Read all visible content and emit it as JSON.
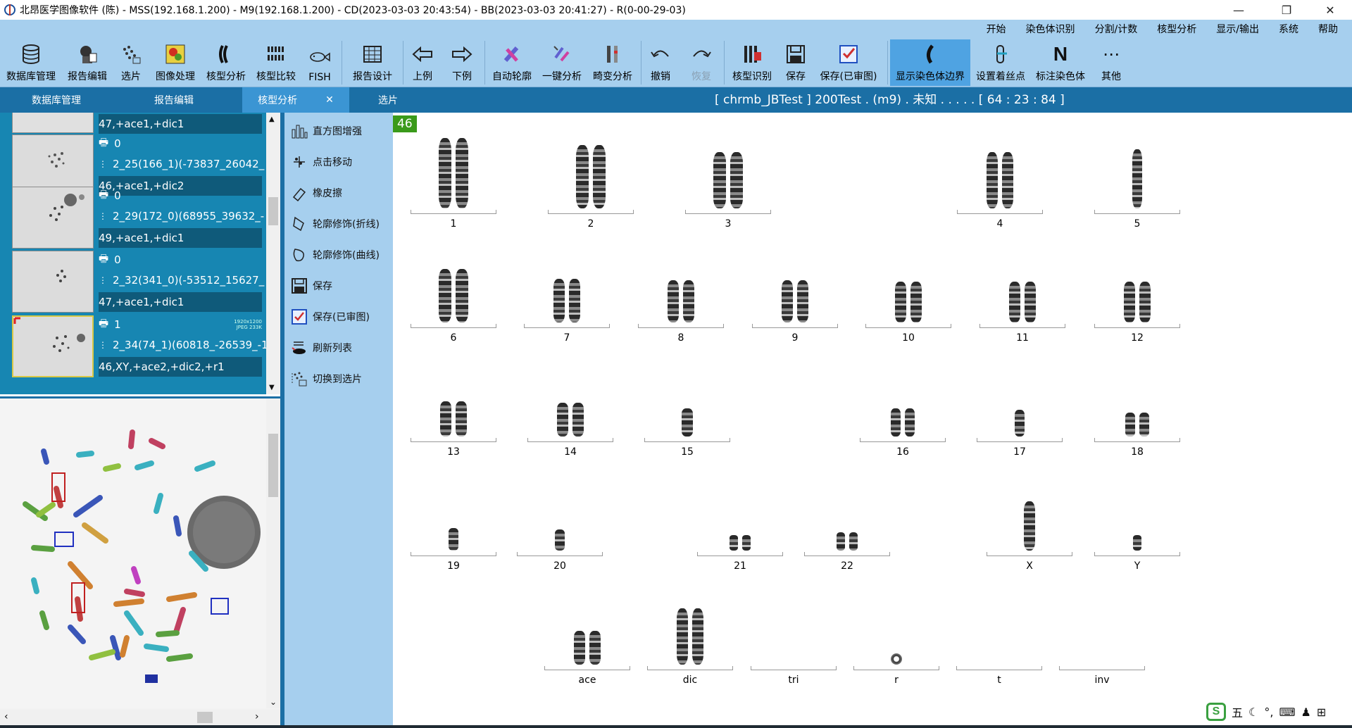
{
  "window": {
    "title": "北昂医学图像软件 (陈) - MSS(192.168.1.200) - M9(192.168.1.200) - CD(2023-03-03 20:43:54) - BB(2023-03-03 20:41:27) - R(0-00-29-03)"
  },
  "menu": [
    "开始",
    "染色体识别",
    "分割/计数",
    "核型分析",
    "显示/输出",
    "系统",
    "帮助"
  ],
  "toolbar": [
    {
      "label": "数据库管理",
      "icon": "database-icon"
    },
    {
      "label": "报告编辑",
      "icon": "report-edit-icon"
    },
    {
      "label": "选片",
      "icon": "select-slide-icon"
    },
    {
      "label": "图像处理",
      "icon": "image-process-icon"
    },
    {
      "label": "核型分析",
      "icon": "karyotype-icon"
    },
    {
      "label": "核型比较",
      "icon": "karyo-compare-icon"
    },
    {
      "label": "FISH",
      "icon": "fish-icon"
    },
    {
      "label": "报告设计",
      "icon": "report-design-icon"
    },
    {
      "label": "上例",
      "icon": "prev-case-icon"
    },
    {
      "label": "下例",
      "icon": "next-case-icon"
    },
    {
      "label": "自动轮廓",
      "icon": "auto-contour-icon"
    },
    {
      "label": "一键分析",
      "icon": "one-click-icon"
    },
    {
      "label": "畸变分析",
      "icon": "aberration-icon"
    },
    {
      "label": "撤销",
      "icon": "undo-icon"
    },
    {
      "label": "恢复",
      "icon": "redo-icon"
    },
    {
      "label": "核型识别",
      "icon": "karyo-recognize-icon"
    },
    {
      "label": "保存",
      "icon": "save-icon"
    },
    {
      "label": "保存(已审图)",
      "icon": "save-reviewed-icon"
    },
    {
      "label": "显示染色体边界",
      "icon": "show-boundary-icon"
    },
    {
      "label": "设置着丝点",
      "icon": "centromere-icon"
    },
    {
      "label": "标注染色体",
      "icon": "label-chromosome-icon"
    },
    {
      "label": "其他",
      "icon": "more-icon"
    }
  ],
  "tabs": [
    "数据库管理",
    "报告编辑",
    "核型分析",
    "选片"
  ],
  "tab_close": "✕",
  "case_title": "[ chrmb_JBTest ]    200Test . (m9) . 未知 . . . . .  [ 64 : 23 : 84 ]",
  "thumbs": [
    {
      "count": "",
      "file": "",
      "karyotype": "47,+ace1,+dic1"
    },
    {
      "count": "0",
      "file": "2_25(166_1)(-73837_26042_",
      "karyotype": "46,+ace1,+dic2"
    },
    {
      "count": "0",
      "file": "2_29(172_0)(68955_39632_-",
      "karyotype": "49,+ace1,+dic1"
    },
    {
      "count": "0",
      "file": "2_32(341_0)(-53512_15627_",
      "karyotype": "47,+ace1,+dic1"
    },
    {
      "count": "1",
      "file": "2_34(74_1)(60818_-26539_-1",
      "karyotype": "46,XY,+ace2,+dic2,+r1"
    }
  ],
  "thumb_meta": {
    "res": "1920x1200",
    "fmt": "JPEG 233K"
  },
  "metaphase_count": "46",
  "karyogram_count": "46",
  "side_tools": [
    "直方图增强",
    "点击移动",
    "橡皮擦",
    "轮廓修饰(折线)",
    "轮廓修饰(曲线)",
    "保存",
    "保存(已审图)",
    "刷新列表",
    "切换到选片"
  ],
  "karyogram_labels": [
    "1",
    "2",
    "3",
    "4",
    "5",
    "6",
    "7",
    "8",
    "9",
    "10",
    "11",
    "12",
    "13",
    "14",
    "15",
    "16",
    "17",
    "18",
    "19",
    "20",
    "21",
    "22",
    "X",
    "Y",
    "ace",
    "dic",
    "tri",
    "r",
    "t",
    "inv"
  ],
  "ime": {
    "mode": "五"
  }
}
